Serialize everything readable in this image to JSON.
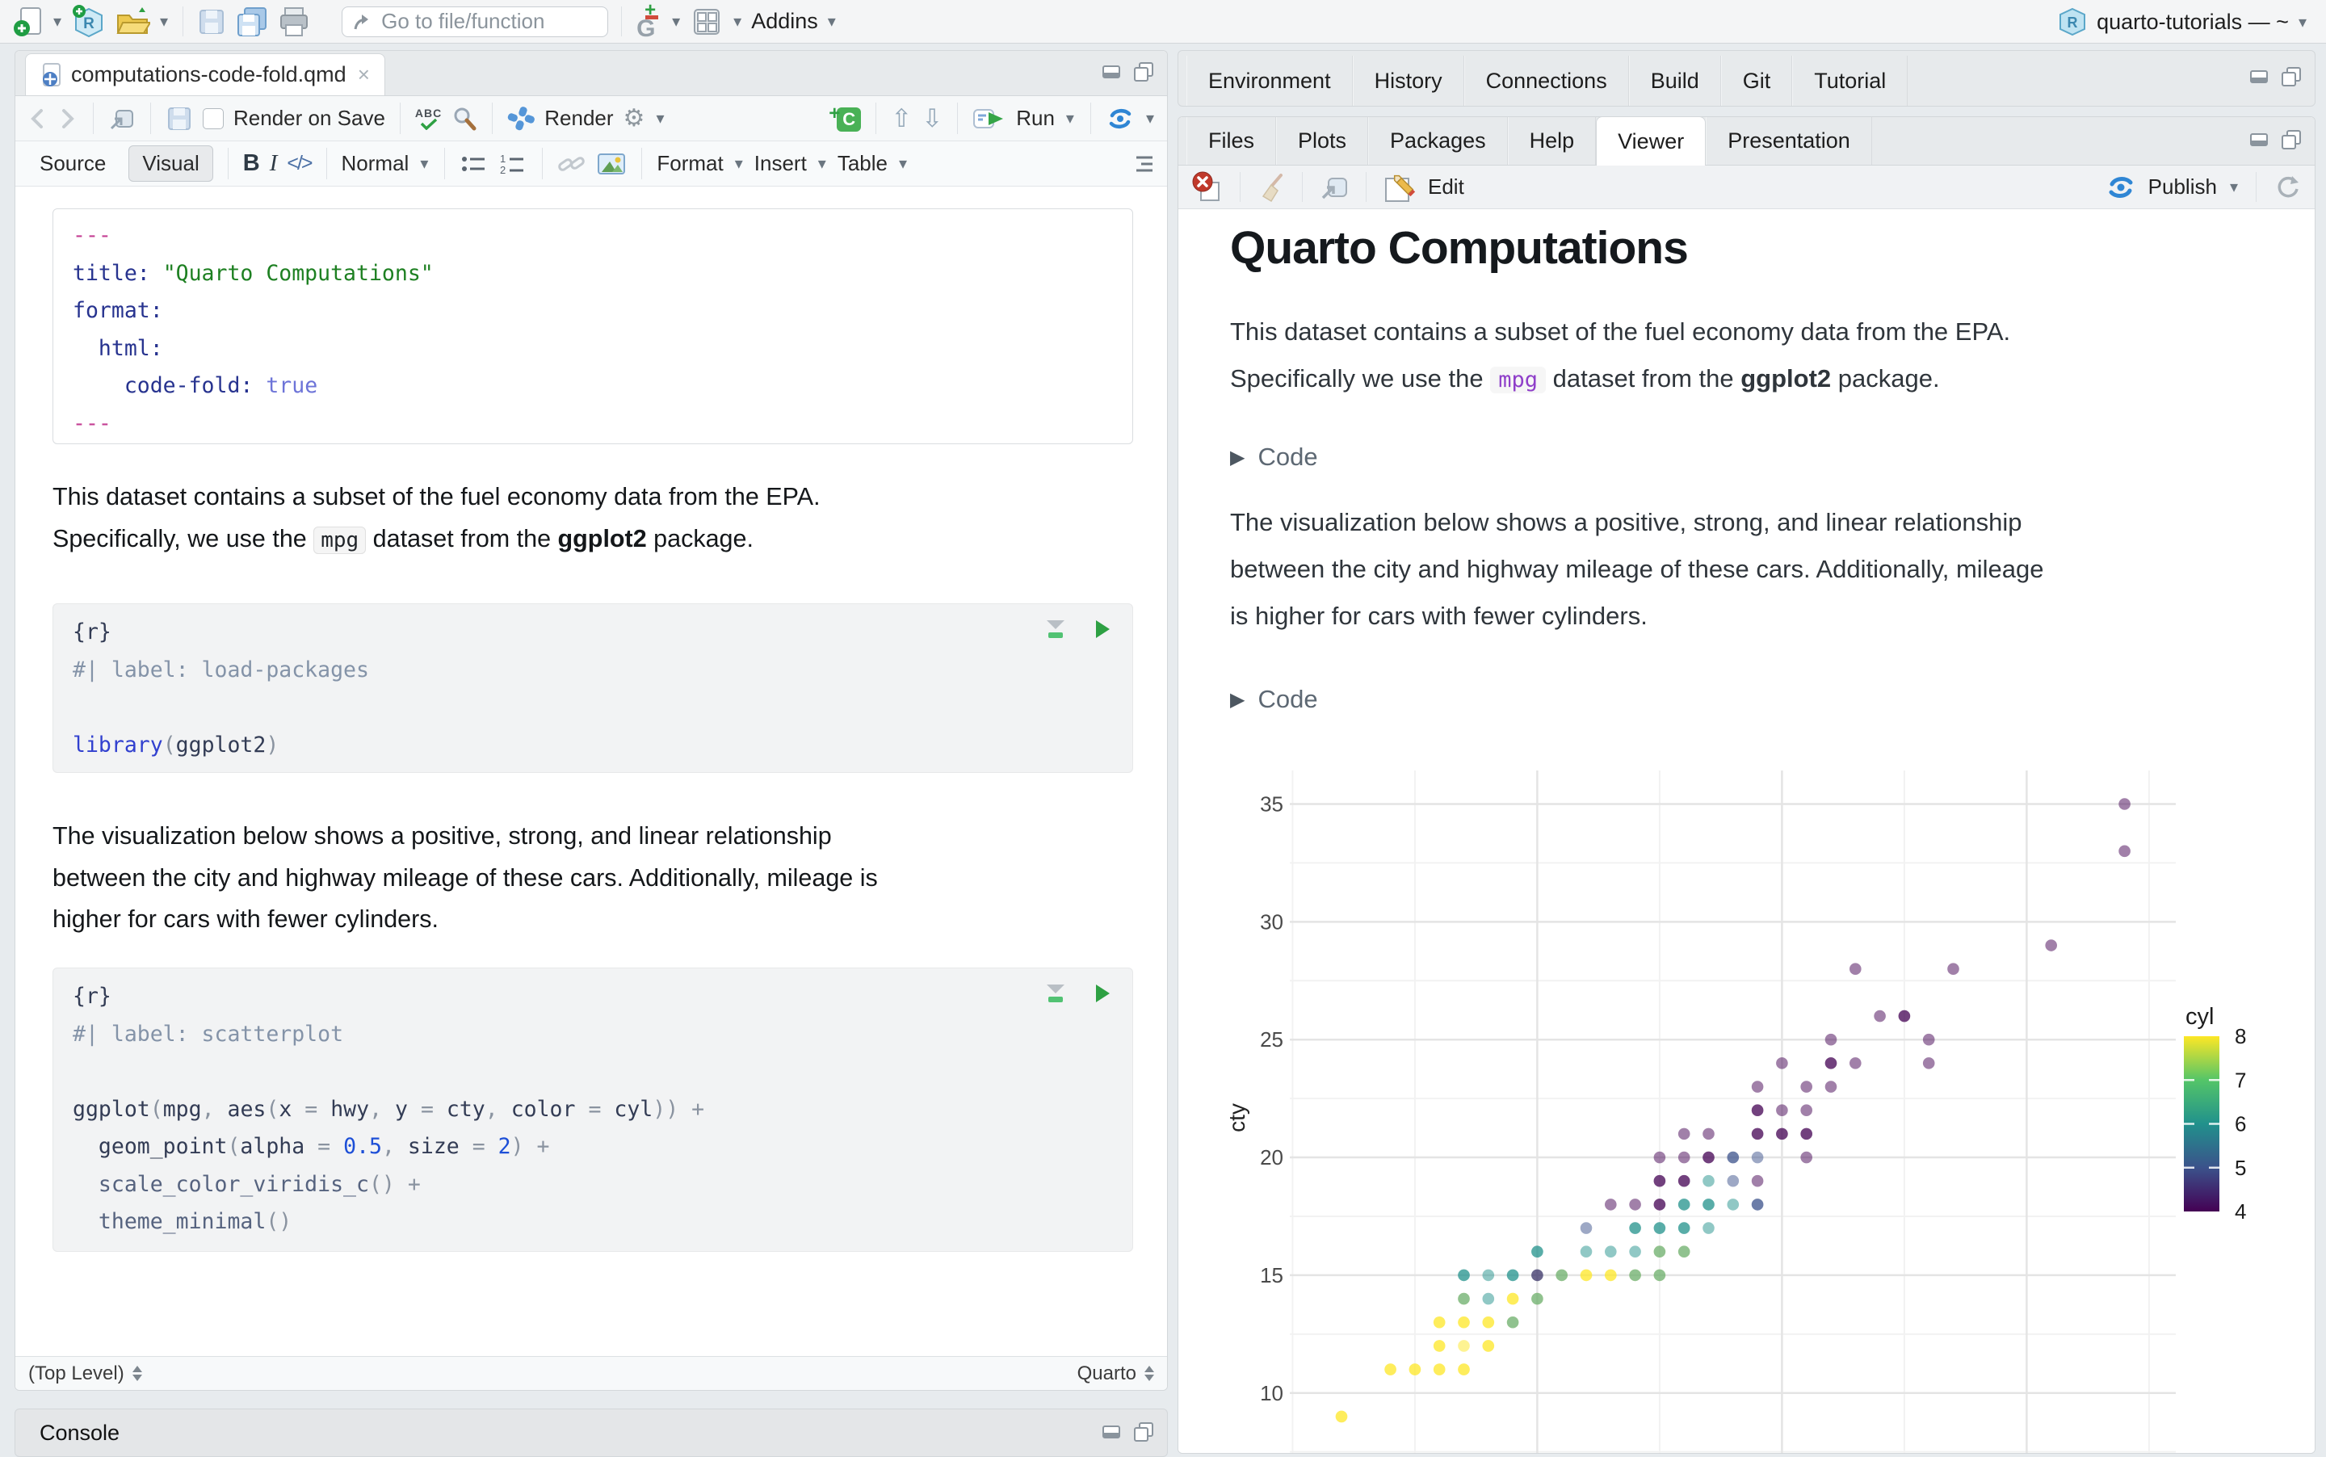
{
  "window": {
    "project": "quarto-tutorials — ~"
  },
  "main_toolbar": {
    "goto_placeholder": "Go to file/function",
    "addins_label": "Addins"
  },
  "editor": {
    "tab_title": "computations-code-fold.qmd",
    "render_on_save": "Render on Save",
    "render_label": "Render",
    "run_label": "Run",
    "source_label": "Source",
    "visual_label": "Visual",
    "normal_label": "Normal",
    "format_label": "Format",
    "insert_label": "Insert",
    "table_label": "Table",
    "code_icon_label": "</>",
    "bold_label": "B",
    "italic_label": "I",
    "status_left": "(Top Level)",
    "status_right": "Quarto",
    "console_label": "Console",
    "yaml_lines": [
      [
        [
          "---",
          "ym"
        ]
      ],
      [
        [
          "title: ",
          "k"
        ],
        [
          "\"Quarto Computations\"",
          "s"
        ]
      ],
      [
        [
          "format:",
          "k"
        ]
      ],
      [
        [
          "  html:",
          "k"
        ]
      ],
      [
        [
          "    code-fold: ",
          "k"
        ],
        [
          "true",
          "bo"
        ]
      ],
      [
        [
          "---",
          "ym"
        ]
      ]
    ],
    "para1_lines": [
      [
        [
          "This dataset contains a subset of the fuel economy data from the EPA.",
          ""
        ]
      ],
      [
        [
          "Specifically, we use the ",
          ""
        ],
        [
          "mpg",
          "icode"
        ],
        [
          " dataset from the ",
          ""
        ],
        [
          "ggplot2",
          "b"
        ],
        [
          " package.",
          ""
        ]
      ]
    ],
    "chunk1_lines": [
      [
        [
          "{r}",
          "br"
        ]
      ],
      [
        [
          "#| label: load-packages",
          "cm"
        ]
      ],
      [],
      [
        [
          "library",
          "kw"
        ],
        [
          "(",
          "pr"
        ],
        [
          "ggplot2",
          "br"
        ],
        [
          ")",
          "pr"
        ]
      ]
    ],
    "para2_lines": [
      [
        [
          "The visualization below shows a positive, strong, and linear relationship",
          ""
        ]
      ],
      [
        [
          "between the city and highway mileage of these cars. Additionally, mileage is",
          ""
        ]
      ],
      [
        [
          "higher for cars with fewer cylinders.",
          ""
        ]
      ]
    ],
    "chunk2_lines": [
      [
        [
          "{r}",
          "br"
        ]
      ],
      [
        [
          "#| label: scatterplot",
          "cm"
        ]
      ],
      [],
      [
        [
          "ggplot",
          "fn"
        ],
        [
          "(",
          "pr"
        ],
        [
          "mpg",
          "br"
        ],
        [
          ", ",
          "pr"
        ],
        [
          "aes",
          "fn"
        ],
        [
          "(",
          "pr"
        ],
        [
          "x",
          "br"
        ],
        [
          " ",
          "pr"
        ],
        [
          "=",
          "op"
        ],
        [
          " ",
          "pr"
        ],
        [
          "hwy",
          "br"
        ],
        [
          ", ",
          "pr"
        ],
        [
          "y",
          "br"
        ],
        [
          " ",
          "pr"
        ],
        [
          "=",
          "op"
        ],
        [
          " ",
          "pr"
        ],
        [
          "cty",
          "br"
        ],
        [
          ", ",
          "pr"
        ],
        [
          "color",
          "br"
        ],
        [
          " ",
          "pr"
        ],
        [
          "=",
          "op"
        ],
        [
          " ",
          "pr"
        ],
        [
          "cyl",
          "br"
        ],
        [
          "))",
          "pr"
        ],
        [
          " ",
          "pr"
        ],
        [
          "+",
          "op"
        ]
      ],
      [
        [
          "  geom_point",
          "fn"
        ],
        [
          "(",
          "pr"
        ],
        [
          "alpha",
          "br"
        ],
        [
          " ",
          "pr"
        ],
        [
          "=",
          "op"
        ],
        [
          " ",
          "pr"
        ],
        [
          "0.5",
          "num"
        ],
        [
          ", ",
          "pr"
        ],
        [
          "size",
          "br"
        ],
        [
          " ",
          "pr"
        ],
        [
          "=",
          "op"
        ],
        [
          " ",
          "pr"
        ],
        [
          "2",
          "num"
        ],
        [
          ")",
          "pr"
        ],
        [
          " ",
          "pr"
        ],
        [
          "+",
          "op"
        ]
      ],
      [
        [
          "  scale_color_viridis_c",
          "fn2"
        ],
        [
          "()",
          "pr"
        ],
        [
          " ",
          "pr"
        ],
        [
          "+",
          "op"
        ]
      ],
      [
        [
          "  theme_minimal",
          "fn2"
        ],
        [
          "()",
          "pr"
        ]
      ]
    ]
  },
  "right_top_tabs": [
    "Environment",
    "History",
    "Connections",
    "Build",
    "Git",
    "Tutorial"
  ],
  "right_bottom_tabs": [
    "Files",
    "Plots",
    "Packages",
    "Help",
    "Viewer",
    "Presentation"
  ],
  "right_bottom_active": "Viewer",
  "viewer": {
    "edit_label": "Edit",
    "publish_label": "Publish",
    "title": "Quarto Computations",
    "code_fold_label": "Code",
    "para1_lines": [
      [
        [
          "This dataset contains a subset of the fuel economy data from the EPA.",
          ""
        ]
      ],
      [
        [
          "Specifically we use the ",
          ""
        ],
        [
          "mpg",
          "vcode"
        ],
        [
          " dataset from the ",
          ""
        ],
        [
          "ggplot2",
          "b"
        ],
        [
          " package.",
          ""
        ]
      ]
    ],
    "para2_lines": [
      [
        [
          "The visualization below shows a positive, strong, and linear relationship",
          ""
        ]
      ],
      [
        [
          "between the city and highway mileage of these cars. Additionally, mileage",
          ""
        ]
      ],
      [
        [
          "is higher for cars with fewer cylinders.",
          ""
        ]
      ]
    ]
  },
  "chart_data": {
    "type": "scatter",
    "title": "",
    "xlabel": "",
    "ylabel": "cty",
    "x_field": "hwy",
    "color_field": "cyl",
    "y_ticks": [
      10,
      15,
      20,
      25,
      30,
      35
    ],
    "y_gridlines_minor": [
      7.5,
      12.5,
      17.5,
      22.5,
      27.5,
      32.5
    ],
    "x_gridlines_major": [
      20,
      30,
      40
    ],
    "x_gridlines_minor": [
      10,
      15,
      25,
      35,
      45
    ],
    "xlim": [
      9.9,
      46.2
    ],
    "ylim": [
      7.3,
      36.1
    ],
    "point_alpha": 0.5,
    "color_map": {
      "4": "#440154",
      "5": "#3b528b",
      "6": "#21918c",
      "8": "#fde725"
    },
    "legend": {
      "title": "cyl",
      "ticks": [
        8,
        7,
        6,
        5,
        4
      ],
      "gradient": [
        "#fde725",
        "#54c568",
        "#21918c",
        "#3b528b",
        "#440154"
      ]
    },
    "points": [
      [
        12,
        9,
        8,
        2
      ],
      [
        14,
        11,
        8,
        2
      ],
      [
        15,
        11,
        8,
        2
      ],
      [
        16,
        11,
        8,
        2
      ],
      [
        17,
        11,
        8,
        2
      ],
      [
        16,
        12,
        8,
        2
      ],
      [
        17,
        12,
        8,
        1
      ],
      [
        18,
        12,
        8,
        2
      ],
      [
        16,
        13,
        8,
        2
      ],
      [
        17,
        13,
        8,
        2
      ],
      [
        18,
        13,
        8,
        2
      ],
      [
        19,
        13,
        8,
        1
      ],
      [
        19,
        13,
        6,
        1
      ],
      [
        17,
        14,
        8,
        1
      ],
      [
        17,
        14,
        6,
        1
      ],
      [
        18,
        14,
        6,
        1
      ],
      [
        19,
        14,
        8,
        2
      ],
      [
        20,
        14,
        8,
        1
      ],
      [
        20,
        14,
        6,
        1
      ],
      [
        17,
        15,
        6,
        2
      ],
      [
        18,
        15,
        6,
        1
      ],
      [
        19,
        15,
        6,
        2
      ],
      [
        20,
        15,
        6,
        1
      ],
      [
        20,
        15,
        4,
        1
      ],
      [
        21,
        15,
        8,
        1
      ],
      [
        21,
        15,
        6,
        1
      ],
      [
        22,
        15,
        8,
        2
      ],
      [
        23,
        15,
        8,
        2
      ],
      [
        24,
        15,
        8,
        1
      ],
      [
        24,
        15,
        6,
        1
      ],
      [
        25,
        15,
        8,
        1
      ],
      [
        25,
        15,
        6,
        1
      ],
      [
        20,
        16,
        6,
        2
      ],
      [
        22,
        16,
        6,
        1
      ],
      [
        23,
        16,
        6,
        1
      ],
      [
        24,
        16,
        6,
        1
      ],
      [
        25,
        16,
        8,
        1
      ],
      [
        25,
        16,
        6,
        1
      ],
      [
        26,
        16,
        8,
        1
      ],
      [
        26,
        16,
        6,
        1
      ],
      [
        22,
        17,
        5,
        1
      ],
      [
        24,
        17,
        6,
        2
      ],
      [
        25,
        17,
        6,
        2
      ],
      [
        26,
        17,
        6,
        2
      ],
      [
        27,
        17,
        6,
        1
      ],
      [
        23,
        18,
        4,
        1
      ],
      [
        24,
        18,
        4,
        1
      ],
      [
        25,
        18,
        4,
        2
      ],
      [
        26,
        18,
        6,
        2
      ],
      [
        27,
        18,
        6,
        2
      ],
      [
        28,
        18,
        6,
        1
      ],
      [
        29,
        18,
        5,
        2
      ],
      [
        25,
        19,
        4,
        2
      ],
      [
        26,
        19,
        4,
        2
      ],
      [
        27,
        19,
        6,
        1
      ],
      [
        28,
        19,
        5,
        1
      ],
      [
        29,
        19,
        4,
        1
      ],
      [
        25,
        20,
        4,
        1
      ],
      [
        26,
        20,
        4,
        1
      ],
      [
        27,
        20,
        4,
        2
      ],
      [
        28,
        20,
        5,
        2
      ],
      [
        29,
        20,
        5,
        1
      ],
      [
        31,
        20,
        4,
        1
      ],
      [
        26,
        21,
        4,
        1
      ],
      [
        27,
        21,
        4,
        1
      ],
      [
        29,
        21,
        4,
        2
      ],
      [
        30,
        21,
        4,
        2
      ],
      [
        31,
        21,
        4,
        2
      ],
      [
        29,
        22,
        4,
        2
      ],
      [
        30,
        22,
        4,
        1
      ],
      [
        31,
        22,
        4,
        1
      ],
      [
        29,
        23,
        4,
        1
      ],
      [
        31,
        23,
        4,
        1
      ],
      [
        32,
        23,
        4,
        1
      ],
      [
        30,
        24,
        4,
        1
      ],
      [
        32,
        24,
        4,
        2
      ],
      [
        33,
        24,
        4,
        1
      ],
      [
        36,
        24,
        4,
        1
      ],
      [
        32,
        25,
        4,
        1
      ],
      [
        36,
        25,
        4,
        1
      ],
      [
        34,
        26,
        4,
        1
      ],
      [
        35,
        26,
        4,
        2
      ],
      [
        33,
        28,
        4,
        1
      ],
      [
        37,
        28,
        4,
        1
      ],
      [
        41,
        29,
        4,
        1
      ],
      [
        44,
        33,
        4,
        1
      ],
      [
        44,
        35,
        4,
        1
      ]
    ]
  }
}
